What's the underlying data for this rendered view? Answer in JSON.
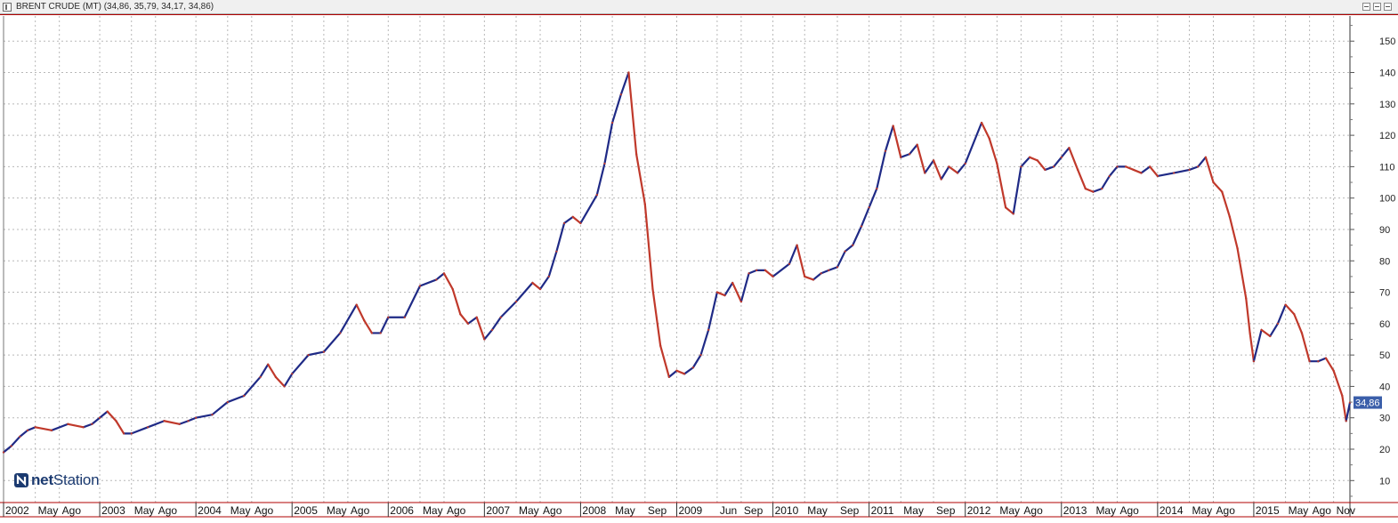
{
  "window": {
    "title": "BRENT CRUDE (MT) (34,86, 35,79, 34,17, 34,86)",
    "icon": "chart-window-icon",
    "buttons": [
      "minimize-icon",
      "maximize-icon",
      "close-icon"
    ]
  },
  "logo": {
    "prefix": "net",
    "suffix": "Station",
    "icon": "netstation-logo-icon"
  },
  "colors": {
    "up": "#1f2a86",
    "down": "#c0392b",
    "grid": "#b8b8b8",
    "axis_frame": "#b00000",
    "badge": "#3b5faa"
  },
  "chart_data": {
    "type": "line",
    "title": "BRENT CRUDE (MT)",
    "last_value_label": "34,86",
    "y_ticks": [
      10,
      20,
      30,
      40,
      50,
      60,
      70,
      80,
      90,
      100,
      110,
      120,
      130,
      140,
      150
    ],
    "ylim": [
      3,
      158
    ],
    "xlim": [
      2002.0,
      2016.0
    ],
    "grid": true,
    "x_labels": [
      {
        "x": 2002.0,
        "label": "2002"
      },
      {
        "x": 2002.33,
        "label": "May"
      },
      {
        "x": 2002.58,
        "label": "Ago"
      },
      {
        "x": 2003.0,
        "label": "2003"
      },
      {
        "x": 2003.33,
        "label": "May"
      },
      {
        "x": 2003.58,
        "label": "Ago"
      },
      {
        "x": 2004.0,
        "label": "2004"
      },
      {
        "x": 2004.33,
        "label": "May"
      },
      {
        "x": 2004.58,
        "label": "Ago"
      },
      {
        "x": 2005.0,
        "label": "2005"
      },
      {
        "x": 2005.33,
        "label": "May"
      },
      {
        "x": 2005.58,
        "label": "Ago"
      },
      {
        "x": 2006.0,
        "label": "2006"
      },
      {
        "x": 2006.33,
        "label": "May"
      },
      {
        "x": 2006.58,
        "label": "Ago"
      },
      {
        "x": 2007.0,
        "label": "2007"
      },
      {
        "x": 2007.33,
        "label": "May"
      },
      {
        "x": 2007.58,
        "label": "Ago"
      },
      {
        "x": 2008.0,
        "label": "2008"
      },
      {
        "x": 2008.33,
        "label": "May"
      },
      {
        "x": 2008.67,
        "label": "Sep"
      },
      {
        "x": 2009.0,
        "label": "2009"
      },
      {
        "x": 2009.42,
        "label": "Jun"
      },
      {
        "x": 2009.67,
        "label": "Sep"
      },
      {
        "x": 2010.0,
        "label": "2010"
      },
      {
        "x": 2010.33,
        "label": "May"
      },
      {
        "x": 2010.67,
        "label": "Sep"
      },
      {
        "x": 2011.0,
        "label": "2011"
      },
      {
        "x": 2011.33,
        "label": "May"
      },
      {
        "x": 2011.67,
        "label": "Sep"
      },
      {
        "x": 2012.0,
        "label": "2012"
      },
      {
        "x": 2012.33,
        "label": "May"
      },
      {
        "x": 2012.58,
        "label": "Ago"
      },
      {
        "x": 2013.0,
        "label": "2013"
      },
      {
        "x": 2013.33,
        "label": "May"
      },
      {
        "x": 2013.58,
        "label": "Ago"
      },
      {
        "x": 2014.0,
        "label": "2014"
      },
      {
        "x": 2014.33,
        "label": "May"
      },
      {
        "x": 2014.58,
        "label": "Ago"
      },
      {
        "x": 2015.0,
        "label": "2015"
      },
      {
        "x": 2015.33,
        "label": "May"
      },
      {
        "x": 2015.58,
        "label": "Ago"
      },
      {
        "x": 2015.83,
        "label": "Nov"
      }
    ],
    "series": [
      {
        "points": [
          [
            2002.0,
            19
          ],
          [
            2002.08,
            21
          ],
          [
            2002.17,
            24
          ],
          [
            2002.25,
            26
          ],
          [
            2002.33,
            27
          ],
          [
            2002.5,
            26
          ],
          [
            2002.67,
            28
          ],
          [
            2002.83,
            27
          ],
          [
            2002.92,
            28
          ],
          [
            2003.0,
            30
          ],
          [
            2003.08,
            32
          ],
          [
            2003.17,
            29
          ],
          [
            2003.25,
            25
          ],
          [
            2003.33,
            25
          ],
          [
            2003.5,
            27
          ],
          [
            2003.67,
            29
          ],
          [
            2003.83,
            28
          ],
          [
            2003.92,
            29
          ],
          [
            2004.0,
            30
          ],
          [
            2004.17,
            31
          ],
          [
            2004.33,
            35
          ],
          [
            2004.5,
            37
          ],
          [
            2004.67,
            43
          ],
          [
            2004.75,
            47
          ],
          [
            2004.83,
            43
          ],
          [
            2004.92,
            40
          ],
          [
            2005.0,
            44
          ],
          [
            2005.17,
            50
          ],
          [
            2005.33,
            51
          ],
          [
            2005.5,
            57
          ],
          [
            2005.67,
            66
          ],
          [
            2005.75,
            61
          ],
          [
            2005.83,
            57
          ],
          [
            2005.92,
            57
          ],
          [
            2006.0,
            62
          ],
          [
            2006.17,
            62
          ],
          [
            2006.33,
            72
          ],
          [
            2006.5,
            74
          ],
          [
            2006.58,
            76
          ],
          [
            2006.67,
            71
          ],
          [
            2006.75,
            63
          ],
          [
            2006.83,
            60
          ],
          [
            2006.92,
            62
          ],
          [
            2007.0,
            55
          ],
          [
            2007.08,
            58
          ],
          [
            2007.17,
            62
          ],
          [
            2007.33,
            67
          ],
          [
            2007.5,
            73
          ],
          [
            2007.58,
            71
          ],
          [
            2007.67,
            75
          ],
          [
            2007.75,
            83
          ],
          [
            2007.83,
            92
          ],
          [
            2007.92,
            94
          ],
          [
            2008.0,
            92
          ],
          [
            2008.17,
            101
          ],
          [
            2008.25,
            111
          ],
          [
            2008.33,
            124
          ],
          [
            2008.42,
            133
          ],
          [
            2008.5,
            140
          ],
          [
            2008.58,
            114
          ],
          [
            2008.67,
            98
          ],
          [
            2008.75,
            71
          ],
          [
            2008.83,
            53
          ],
          [
            2008.92,
            43
          ],
          [
            2009.0,
            45
          ],
          [
            2009.08,
            44
          ],
          [
            2009.17,
            46
          ],
          [
            2009.25,
            50
          ],
          [
            2009.33,
            58
          ],
          [
            2009.42,
            70
          ],
          [
            2009.5,
            69
          ],
          [
            2009.58,
            73
          ],
          [
            2009.67,
            67
          ],
          [
            2009.75,
            76
          ],
          [
            2009.83,
            77
          ],
          [
            2009.92,
            77
          ],
          [
            2010.0,
            75
          ],
          [
            2010.17,
            79
          ],
          [
            2010.25,
            85
          ],
          [
            2010.33,
            75
          ],
          [
            2010.42,
            74
          ],
          [
            2010.5,
            76
          ],
          [
            2010.58,
            77
          ],
          [
            2010.67,
            78
          ],
          [
            2010.75,
            83
          ],
          [
            2010.83,
            85
          ],
          [
            2010.92,
            91
          ],
          [
            2011.0,
            97
          ],
          [
            2011.08,
            103
          ],
          [
            2011.17,
            115
          ],
          [
            2011.25,
            123
          ],
          [
            2011.33,
            113
          ],
          [
            2011.42,
            114
          ],
          [
            2011.5,
            117
          ],
          [
            2011.58,
            108
          ],
          [
            2011.67,
            112
          ],
          [
            2011.75,
            106
          ],
          [
            2011.83,
            110
          ],
          [
            2011.92,
            108
          ],
          [
            2012.0,
            111
          ],
          [
            2012.17,
            124
          ],
          [
            2012.25,
            119
          ],
          [
            2012.33,
            111
          ],
          [
            2012.42,
            97
          ],
          [
            2012.5,
            95
          ],
          [
            2012.58,
            110
          ],
          [
            2012.67,
            113
          ],
          [
            2012.75,
            112
          ],
          [
            2012.83,
            109
          ],
          [
            2012.92,
            110
          ],
          [
            2013.0,
            113
          ],
          [
            2013.08,
            116
          ],
          [
            2013.17,
            109
          ],
          [
            2013.25,
            103
          ],
          [
            2013.33,
            102
          ],
          [
            2013.42,
            103
          ],
          [
            2013.5,
            107
          ],
          [
            2013.58,
            110
          ],
          [
            2013.67,
            110
          ],
          [
            2013.75,
            109
          ],
          [
            2013.83,
            108
          ],
          [
            2013.92,
            110
          ],
          [
            2014.0,
            107
          ],
          [
            2014.17,
            108
          ],
          [
            2014.33,
            109
          ],
          [
            2014.42,
            110
          ],
          [
            2014.5,
            113
          ],
          [
            2014.58,
            105
          ],
          [
            2014.67,
            102
          ],
          [
            2014.75,
            94
          ],
          [
            2014.83,
            84
          ],
          [
            2014.92,
            68
          ],
          [
            2014.96,
            57
          ],
          [
            2015.0,
            48
          ],
          [
            2015.08,
            58
          ],
          [
            2015.17,
            56
          ],
          [
            2015.25,
            60
          ],
          [
            2015.33,
            66
          ],
          [
            2015.42,
            63
          ],
          [
            2015.5,
            57
          ],
          [
            2015.58,
            48
          ],
          [
            2015.67,
            48
          ],
          [
            2015.75,
            49
          ],
          [
            2015.83,
            45
          ],
          [
            2015.92,
            37
          ],
          [
            2015.96,
            29
          ],
          [
            2016.0,
            34.86
          ]
        ]
      }
    ]
  }
}
